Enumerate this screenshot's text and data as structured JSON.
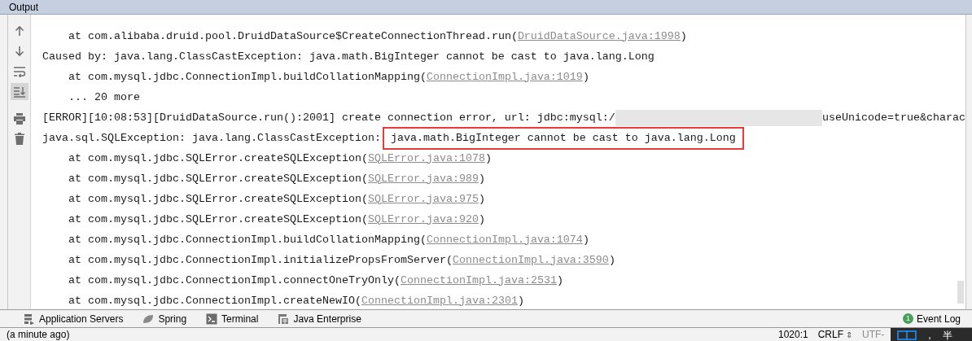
{
  "panel": {
    "title": "Output"
  },
  "toolbar": [
    {
      "kind": "up",
      "selected": false
    },
    {
      "kind": "down",
      "selected": false
    },
    {
      "kind": "wrap",
      "selected": false
    },
    {
      "kind": "scroll-end",
      "selected": true
    },
    {
      "kind": "print",
      "selected": false
    },
    {
      "kind": "trash",
      "selected": false
    }
  ],
  "lines": [
    {
      "indent": true,
      "parts": [
        {
          "text": "at com.alibaba.druid.pool.DruidDataSource$CreateConnectionThread.run("
        },
        {
          "text": "DruidDataSource.java:1998",
          "link": true
        },
        {
          "text": ")"
        }
      ]
    },
    {
      "indent": false,
      "parts": [
        {
          "text": "Caused by: java.lang.ClassCastException: java.math.BigInteger cannot be cast to java.lang.Long"
        }
      ]
    },
    {
      "indent": true,
      "parts": [
        {
          "text": "at com.mysql.jdbc.ConnectionImpl.buildCollationMapping("
        },
        {
          "text": "ConnectionImpl.java:1019",
          "link": true
        },
        {
          "text": ")"
        }
      ]
    },
    {
      "indent": true,
      "parts": [
        {
          "text": "... 20 more"
        }
      ]
    },
    {
      "indent": false,
      "parts": [
        {
          "text": "[ERROR][10:08:53][DruidDataSource.run():2001] create connection error, url: jdbc:mysql:/"
        },
        {
          "redacted": true
        },
        {
          "text": "useUnicode=true&charac"
        }
      ]
    },
    {
      "indent": false,
      "parts": [
        {
          "text": "java.sql.SQLException: java.lang.ClassCastException:"
        },
        {
          "text": "java.math.BigInteger cannot be cast to java.lang.Long",
          "boxed": true
        }
      ]
    },
    {
      "indent": true,
      "parts": [
        {
          "text": "at com.mysql.jdbc.SQLError.createSQLException("
        },
        {
          "text": "SQLError.java:1078",
          "link": true
        },
        {
          "text": ")"
        }
      ]
    },
    {
      "indent": true,
      "parts": [
        {
          "text": "at com.mysql.jdbc.SQLError.createSQLException("
        },
        {
          "text": "SQLError.java:989",
          "link": true
        },
        {
          "text": ")"
        }
      ]
    },
    {
      "indent": true,
      "parts": [
        {
          "text": "at com.mysql.jdbc.SQLError.createSQLException("
        },
        {
          "text": "SQLError.java:975",
          "link": true
        },
        {
          "text": ")"
        }
      ]
    },
    {
      "indent": true,
      "parts": [
        {
          "text": "at com.mysql.jdbc.SQLError.createSQLException("
        },
        {
          "text": "SQLError.java:920",
          "link": true
        },
        {
          "text": ")"
        }
      ]
    },
    {
      "indent": true,
      "parts": [
        {
          "text": "at com.mysql.jdbc.ConnectionImpl.buildCollationMapping("
        },
        {
          "text": "ConnectionImpl.java:1074",
          "link": true
        },
        {
          "text": ")"
        }
      ]
    },
    {
      "indent": true,
      "parts": [
        {
          "text": "at com.mysql.jdbc.ConnectionImpl.initializePropsFromServer("
        },
        {
          "text": "ConnectionImpl.java:3590",
          "link": true
        },
        {
          "text": ")"
        }
      ]
    },
    {
      "indent": true,
      "parts": [
        {
          "text": "at com.mysql.jdbc.ConnectionImpl.connectOneTryOnly("
        },
        {
          "text": "ConnectionImpl.java:2531",
          "link": true
        },
        {
          "text": ")"
        }
      ]
    },
    {
      "indent": true,
      "parts": [
        {
          "text": "at com.mysql.jdbc.ConnectionImpl.createNewIO("
        },
        {
          "text": "ConnectionImpl.java:2301",
          "link": true
        },
        {
          "text": ")"
        }
      ]
    }
  ],
  "tool_tabs": [
    {
      "kind": "servers",
      "label": "Application Servers"
    },
    {
      "kind": "spring",
      "label": "Spring"
    },
    {
      "kind": "terminal",
      "label": "Terminal"
    },
    {
      "kind": "javaee",
      "label": "Java Enterprise"
    }
  ],
  "event_log": {
    "badge": "1",
    "label": "Event Log"
  },
  "status_bar": {
    "message": "(a minute ago)",
    "position": "1020:1",
    "line_separator": "CRLF",
    "line_separator_caret": "⇕",
    "encoding": "UTF-"
  },
  "ime": {
    "punctuation": "，",
    "width_mode": "半"
  }
}
